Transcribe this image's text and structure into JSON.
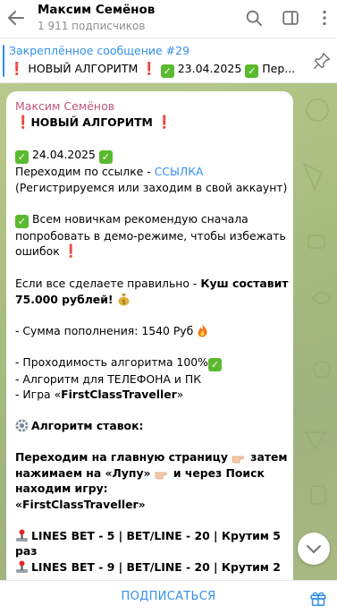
{
  "header": {
    "title": "Максим Семёнов",
    "subscribers": "1 911 подписчиков"
  },
  "pinned": {
    "title": "Закреплённое сообщение #29",
    "text_a": "НОВЫЙ АЛГОРИТМ",
    "text_b": "23.04.2025",
    "text_c": "Пер..."
  },
  "message": {
    "author": "Максим Семёнов",
    "heading": "НОВЫЙ АЛГОРИТМ",
    "date": "24.04.2025",
    "go_link_prefix": "Переходим по ссылке - ",
    "link_text": "ССЫЛКА",
    "register_note": "(Регистрируемся или заходим в свой аккаунт)",
    "newbies_1": "Всем новичкам рекомендую сначала",
    "newbies_2": "попробовать в демо-режиме, чтобы избежать",
    "newbies_3": "ошибок",
    "if_right_prefix": "Если все сделаете правильно - ",
    "jackpot_1": "Куш составит",
    "jackpot_2": "75.000 рублей!",
    "deposit": "- Сумма пополнения: 1540 Руб",
    "passability": "- Проходимость алгоритма 100%",
    "platform": "- Алгоритм для ТЕЛЕФОНА и ПК",
    "game_prefix": "- Игра «",
    "game_name": "FirstClassTraveller",
    "game_suffix": "»",
    "algo_heading": "Алгоритм ставок:",
    "step_1": "Переходим на главную страницу",
    "step_1b": "затем",
    "step_2": "нажимаем на «Лупу»",
    "step_2b": "и через Поиск",
    "step_3": "находим игру:",
    "step_4": "«FirstClassTraveller»",
    "bet_1a": "LINES BET -  5  | BET/LINE - 20    | Крутим 5",
    "bet_1b": "раз",
    "bet_2a": "LINES BET -  9  | BET/LINE - 20    | Крутим 2"
  },
  "bottom": {
    "subscribe_label": "ПОДПИСАТЬСЯ"
  },
  "icons": {
    "back": "back-arrow-icon",
    "search": "search-icon",
    "sidebar": "sidebar-toggle-icon",
    "more": "more-vertical-icon",
    "unpin": "unpin-icon",
    "gift": "gift-icon",
    "scroll": "chevron-down-icon"
  },
  "colors": {
    "accent": "#3390ec",
    "author": "#c0567a",
    "check": "#5aba2f",
    "exclamation": "#e0262e",
    "chat_bg": "#a7bd7f"
  }
}
